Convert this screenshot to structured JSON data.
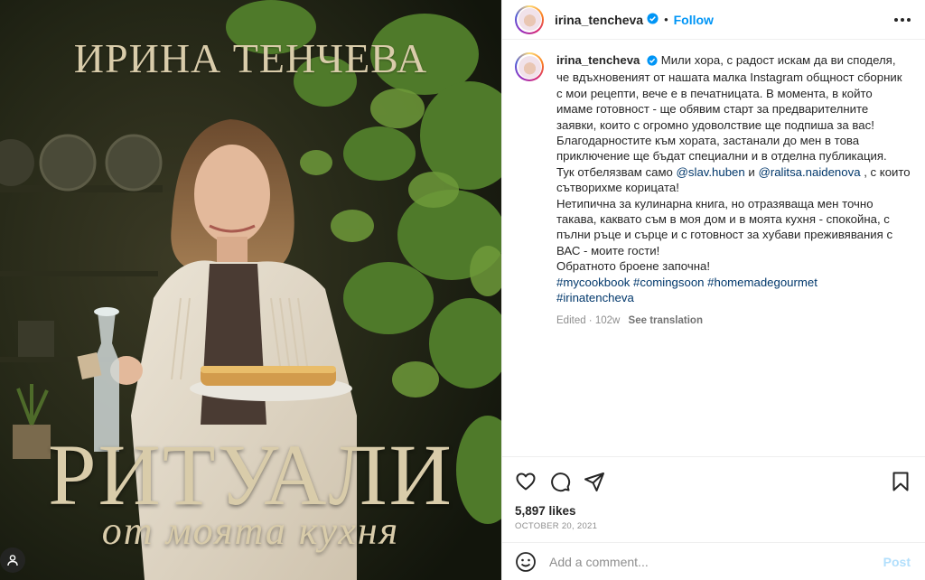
{
  "cover": {
    "author": "ИРИНА ТЕНЧЕВА",
    "title": "РИТУАЛИ",
    "subtitle": "от моята кухня"
  },
  "header": {
    "username": "irina_tencheva",
    "separator": "•",
    "follow_label": "Follow"
  },
  "caption": {
    "username": "irina_tencheva",
    "text1": "Мили хора, с радост искам да ви споделя, че вдъхновеният от нашата малка Instagram общност сборник с мои рецепти, вече е в печатницата. В момента, в който имаме готовност - ще обявим старт за предварителните заявки, които с огромно удоволствие ще подпиша за вас!",
    "text2": "Благодарностите към хората, застанали до мен в това приключение ще бъдат специални и в отделна публикация.",
    "text3a": "Тук отбелязвам само ",
    "mention1": "@slav.huben",
    "text3b": " и ",
    "mention2": "@ralitsa.naidenova",
    "text3c": " , с които сътворихме корицата!",
    "text4": "Нетипична за кулинарна книга, но отразяваща мен точно такава, каквато съм в моя дом и в моята кухня - спокойна, с пълни ръце и сърце и с готовност за хубави преживявания с ВАС - моите гости!",
    "text5": "Обратното броене започна!",
    "tag1": "#mycookbook",
    "tag2": "#comingsoon",
    "tag3": "#homemadegourmet",
    "tag4": "#irinatencheva",
    "edited": "Edited · 102w",
    "see_translation": "See translation"
  },
  "engagement": {
    "likes": "5,897 likes",
    "date": "OCTOBER 20, 2021"
  },
  "comment": {
    "placeholder": "Add a comment...",
    "post_label": "Post"
  },
  "icons": {
    "verified": "verified-badge-icon",
    "like": "heart-icon",
    "comment": "comment-bubble-icon",
    "share": "paper-plane-icon",
    "save": "bookmark-icon",
    "emoji": "smiley-icon",
    "tag": "person-tag-icon",
    "more": "more-options-icon"
  },
  "colors": {
    "link": "#0095f6",
    "mention": "#00376b",
    "muted": "#8e8e8e",
    "cover_text": "#d9ccaa"
  }
}
